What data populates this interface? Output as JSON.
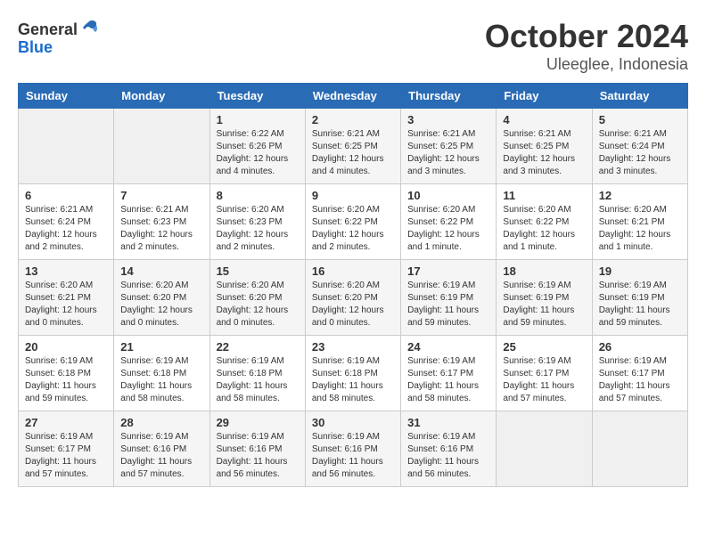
{
  "logo": {
    "general": "General",
    "blue": "Blue"
  },
  "title": "October 2024",
  "location": "Uleeglee, Indonesia",
  "weekdays": [
    "Sunday",
    "Monday",
    "Tuesday",
    "Wednesday",
    "Thursday",
    "Friday",
    "Saturday"
  ],
  "weeks": [
    [
      {
        "day": "",
        "empty": true
      },
      {
        "day": "",
        "empty": true
      },
      {
        "day": "1",
        "sunrise": "Sunrise: 6:22 AM",
        "sunset": "Sunset: 6:26 PM",
        "daylight": "Daylight: 12 hours and 4 minutes."
      },
      {
        "day": "2",
        "sunrise": "Sunrise: 6:21 AM",
        "sunset": "Sunset: 6:25 PM",
        "daylight": "Daylight: 12 hours and 4 minutes."
      },
      {
        "day": "3",
        "sunrise": "Sunrise: 6:21 AM",
        "sunset": "Sunset: 6:25 PM",
        "daylight": "Daylight: 12 hours and 3 minutes."
      },
      {
        "day": "4",
        "sunrise": "Sunrise: 6:21 AM",
        "sunset": "Sunset: 6:25 PM",
        "daylight": "Daylight: 12 hours and 3 minutes."
      },
      {
        "day": "5",
        "sunrise": "Sunrise: 6:21 AM",
        "sunset": "Sunset: 6:24 PM",
        "daylight": "Daylight: 12 hours and 3 minutes."
      }
    ],
    [
      {
        "day": "6",
        "sunrise": "Sunrise: 6:21 AM",
        "sunset": "Sunset: 6:24 PM",
        "daylight": "Daylight: 12 hours and 2 minutes."
      },
      {
        "day": "7",
        "sunrise": "Sunrise: 6:21 AM",
        "sunset": "Sunset: 6:23 PM",
        "daylight": "Daylight: 12 hours and 2 minutes."
      },
      {
        "day": "8",
        "sunrise": "Sunrise: 6:20 AM",
        "sunset": "Sunset: 6:23 PM",
        "daylight": "Daylight: 12 hours and 2 minutes."
      },
      {
        "day": "9",
        "sunrise": "Sunrise: 6:20 AM",
        "sunset": "Sunset: 6:22 PM",
        "daylight": "Daylight: 12 hours and 2 minutes."
      },
      {
        "day": "10",
        "sunrise": "Sunrise: 6:20 AM",
        "sunset": "Sunset: 6:22 PM",
        "daylight": "Daylight: 12 hours and 1 minute."
      },
      {
        "day": "11",
        "sunrise": "Sunrise: 6:20 AM",
        "sunset": "Sunset: 6:22 PM",
        "daylight": "Daylight: 12 hours and 1 minute."
      },
      {
        "day": "12",
        "sunrise": "Sunrise: 6:20 AM",
        "sunset": "Sunset: 6:21 PM",
        "daylight": "Daylight: 12 hours and 1 minute."
      }
    ],
    [
      {
        "day": "13",
        "sunrise": "Sunrise: 6:20 AM",
        "sunset": "Sunset: 6:21 PM",
        "daylight": "Daylight: 12 hours and 0 minutes."
      },
      {
        "day": "14",
        "sunrise": "Sunrise: 6:20 AM",
        "sunset": "Sunset: 6:20 PM",
        "daylight": "Daylight: 12 hours and 0 minutes."
      },
      {
        "day": "15",
        "sunrise": "Sunrise: 6:20 AM",
        "sunset": "Sunset: 6:20 PM",
        "daylight": "Daylight: 12 hours and 0 minutes."
      },
      {
        "day": "16",
        "sunrise": "Sunrise: 6:20 AM",
        "sunset": "Sunset: 6:20 PM",
        "daylight": "Daylight: 12 hours and 0 minutes."
      },
      {
        "day": "17",
        "sunrise": "Sunrise: 6:19 AM",
        "sunset": "Sunset: 6:19 PM",
        "daylight": "Daylight: 11 hours and 59 minutes."
      },
      {
        "day": "18",
        "sunrise": "Sunrise: 6:19 AM",
        "sunset": "Sunset: 6:19 PM",
        "daylight": "Daylight: 11 hours and 59 minutes."
      },
      {
        "day": "19",
        "sunrise": "Sunrise: 6:19 AM",
        "sunset": "Sunset: 6:19 PM",
        "daylight": "Daylight: 11 hours and 59 minutes."
      }
    ],
    [
      {
        "day": "20",
        "sunrise": "Sunrise: 6:19 AM",
        "sunset": "Sunset: 6:18 PM",
        "daylight": "Daylight: 11 hours and 59 minutes."
      },
      {
        "day": "21",
        "sunrise": "Sunrise: 6:19 AM",
        "sunset": "Sunset: 6:18 PM",
        "daylight": "Daylight: 11 hours and 58 minutes."
      },
      {
        "day": "22",
        "sunrise": "Sunrise: 6:19 AM",
        "sunset": "Sunset: 6:18 PM",
        "daylight": "Daylight: 11 hours and 58 minutes."
      },
      {
        "day": "23",
        "sunrise": "Sunrise: 6:19 AM",
        "sunset": "Sunset: 6:18 PM",
        "daylight": "Daylight: 11 hours and 58 minutes."
      },
      {
        "day": "24",
        "sunrise": "Sunrise: 6:19 AM",
        "sunset": "Sunset: 6:17 PM",
        "daylight": "Daylight: 11 hours and 58 minutes."
      },
      {
        "day": "25",
        "sunrise": "Sunrise: 6:19 AM",
        "sunset": "Sunset: 6:17 PM",
        "daylight": "Daylight: 11 hours and 57 minutes."
      },
      {
        "day": "26",
        "sunrise": "Sunrise: 6:19 AM",
        "sunset": "Sunset: 6:17 PM",
        "daylight": "Daylight: 11 hours and 57 minutes."
      }
    ],
    [
      {
        "day": "27",
        "sunrise": "Sunrise: 6:19 AM",
        "sunset": "Sunset: 6:17 PM",
        "daylight": "Daylight: 11 hours and 57 minutes."
      },
      {
        "day": "28",
        "sunrise": "Sunrise: 6:19 AM",
        "sunset": "Sunset: 6:16 PM",
        "daylight": "Daylight: 11 hours and 57 minutes."
      },
      {
        "day": "29",
        "sunrise": "Sunrise: 6:19 AM",
        "sunset": "Sunset: 6:16 PM",
        "daylight": "Daylight: 11 hours and 56 minutes."
      },
      {
        "day": "30",
        "sunrise": "Sunrise: 6:19 AM",
        "sunset": "Sunset: 6:16 PM",
        "daylight": "Daylight: 11 hours and 56 minutes."
      },
      {
        "day": "31",
        "sunrise": "Sunrise: 6:19 AM",
        "sunset": "Sunset: 6:16 PM",
        "daylight": "Daylight: 11 hours and 56 minutes."
      },
      {
        "day": "",
        "empty": true
      },
      {
        "day": "",
        "empty": true
      }
    ]
  ]
}
